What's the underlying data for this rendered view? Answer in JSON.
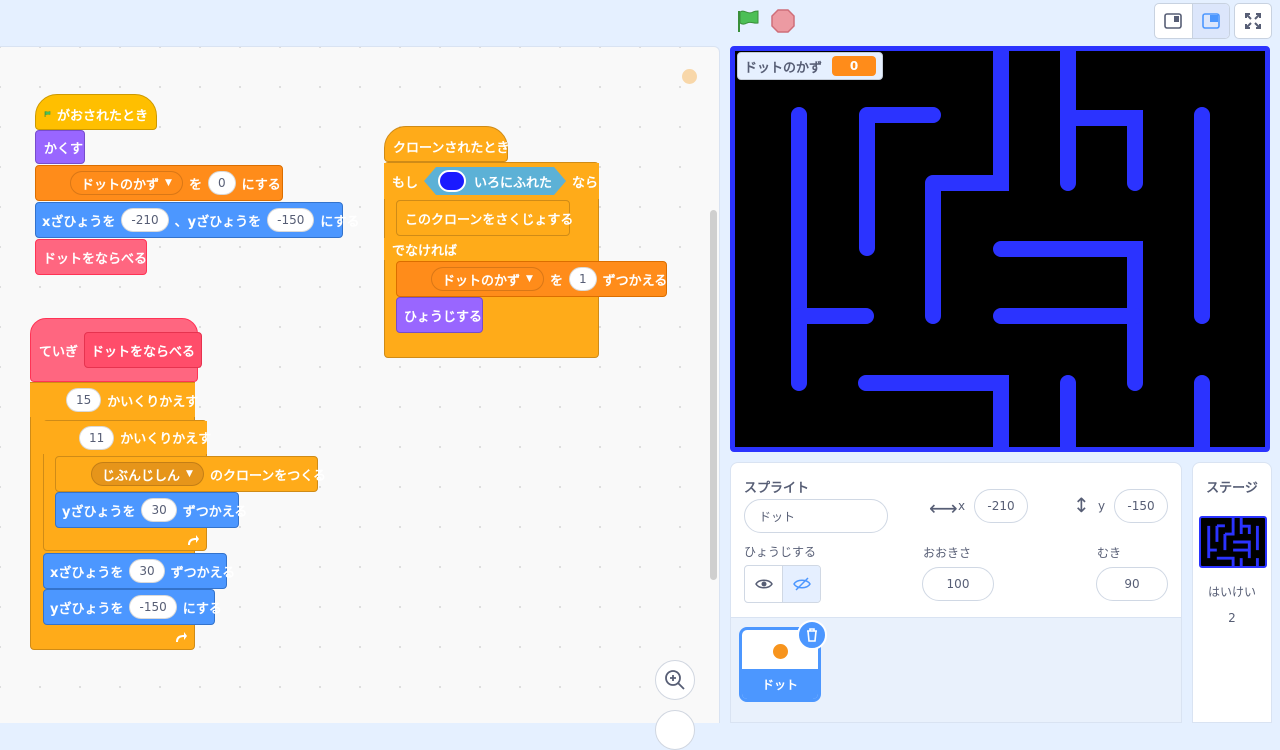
{
  "variable": {
    "name": "ドットのかず",
    "value": "0"
  },
  "scripts": {
    "s1": {
      "hat": "がおされたとき",
      "hide": "かくす",
      "set_pre": "を",
      "set_val": "0",
      "set_post": "にする",
      "goto_x_label": "xざひょうを",
      "goto_x": "-210",
      "goto_y_label": "、yざひょうを",
      "goto_y": "-150",
      "goto_post": "にする",
      "call": "ドットをならべる"
    },
    "s2": {
      "define": "ていぎ",
      "define_name": "ドットをならべる",
      "repeat1": "15",
      "repeat_label": "かいくりかえす",
      "repeat2": "11",
      "clone_target": "じぶんじしん",
      "clone_post": "のクローンをつくる",
      "change_y_label": "yざひょうを",
      "change_y": "30",
      "change_post": "ずつかえる",
      "change_x_label": "xざひょうを",
      "change_x": "30",
      "set_y_label": "yざひょうを",
      "set_y": "-150",
      "set_post": "にする"
    },
    "s3": {
      "hat": "クローンされたとき",
      "if": "もし",
      "touching": "いろにふれた",
      "then": "なら",
      "delete": "このクローンをさくじょする",
      "else": "でなければ",
      "change_pre": "を",
      "change_val": "1",
      "change_post": "ずつかえる",
      "show": "ひょうじする"
    }
  },
  "sprite_info": {
    "sprite_label": "スプライト",
    "sprite_name": "ドット",
    "x_label": "x",
    "x": "-210",
    "y_label": "y",
    "y": "-150",
    "show_label": "ひょうじする",
    "size_label": "おおきさ",
    "size": "100",
    "direction_label": "むき",
    "direction": "90"
  },
  "sprites": [
    {
      "name": "ドット"
    }
  ],
  "stage_panel": {
    "title": "ステージ",
    "backdrop_label": "はいけい",
    "backdrop_count": "2"
  },
  "colors": {
    "maze": "#2b33ff",
    "touch_color": "#1a1aff",
    "dot": "#f7941d"
  }
}
